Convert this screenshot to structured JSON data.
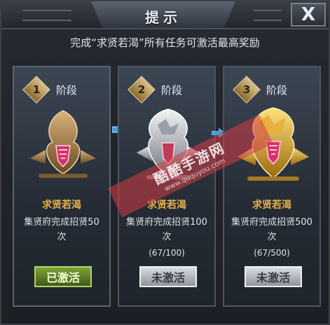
{
  "dialog": {
    "title": "提示",
    "close_label": "X",
    "subtitle": "完成“求贤若渴”所有任务可激活最高奖励"
  },
  "cards": [
    {
      "stage_number": "1",
      "stage_label": "阶段",
      "reward_name": "求贤若渴",
      "description": "集贤府完成招贤50次",
      "progress": "",
      "status": "已激活",
      "state": "activated"
    },
    {
      "stage_number": "2",
      "stage_label": "阶段",
      "reward_name": "求贤若渴",
      "description": "集贤府完成招贤100次",
      "progress": "(67/100)",
      "status": "未激活",
      "state": "inactive"
    },
    {
      "stage_number": "3",
      "stage_label": "阶段",
      "reward_name": "求贤若渴",
      "description": "集贤府完成招贤500次",
      "progress": "(67/500)",
      "status": "未激活",
      "state": "inactive"
    }
  ],
  "watermark": {
    "text": "酷酷手游网",
    "url": "www.ququyou.com"
  },
  "colors": {
    "accent_gold": "#e6b44a",
    "activated_green": "#7fa338",
    "arrow_blue": "#3aa0e8"
  }
}
